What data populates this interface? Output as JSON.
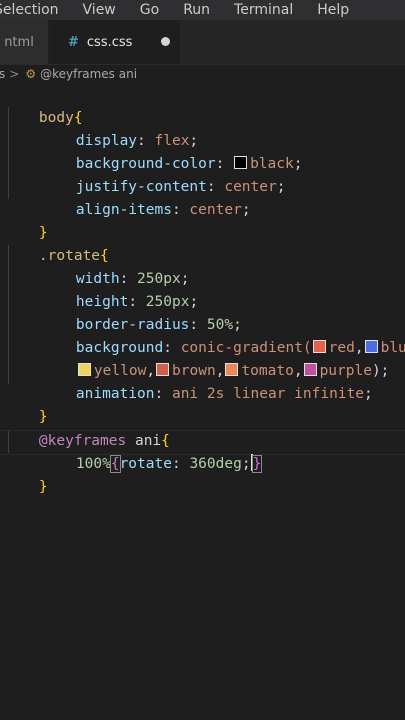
{
  "menu": [
    "Selection",
    "View",
    "Go",
    "Run",
    "Terminal",
    "Help"
  ],
  "tabs": {
    "inactive_label": "ntml",
    "active_label": "css.css",
    "active_icon": "#"
  },
  "breadcrumb": {
    "parent": "s",
    "separator": ">",
    "current": "@keyframes ani"
  },
  "code": {
    "body_selector": "body",
    "open": "{",
    "close": "}",
    "display_prop": "display",
    "display_val": "flex",
    "bg_prop": "background-color",
    "bg_val": "black",
    "jc_prop": "justify-content",
    "jc_val": "center",
    "ai_prop": "align-items",
    "ai_val": "center",
    "rotate_selector": ".rotate",
    "width_prop": "width",
    "width_val": "250px",
    "height_prop": "height",
    "height_val": "250px",
    "br_prop": "border-radius",
    "br_val": "50%",
    "background_prop": "background",
    "conic": "conic-gradient(",
    "c_red": "red",
    "c_blue": "blue",
    "c_yellow": "yellow",
    "c_brown": "brown",
    "c_tomato": "tomato",
    "c_purple": "purple",
    "anim_prop": "animation",
    "anim_val": "ani 2s linear infinite",
    "keyframes_at": "@keyframes",
    "keyframes_name": "ani",
    "kf_stop": "100%",
    "kf_prop": "rotate",
    "kf_val": "360deg"
  },
  "swatch_colors": {
    "black": "#000000",
    "red": "#e8604c",
    "blue": "#4b6ee8",
    "yellow": "#f0d35a",
    "brown": "#d0604c",
    "tomato": "#ec8656",
    "purple": "#c0509c"
  }
}
